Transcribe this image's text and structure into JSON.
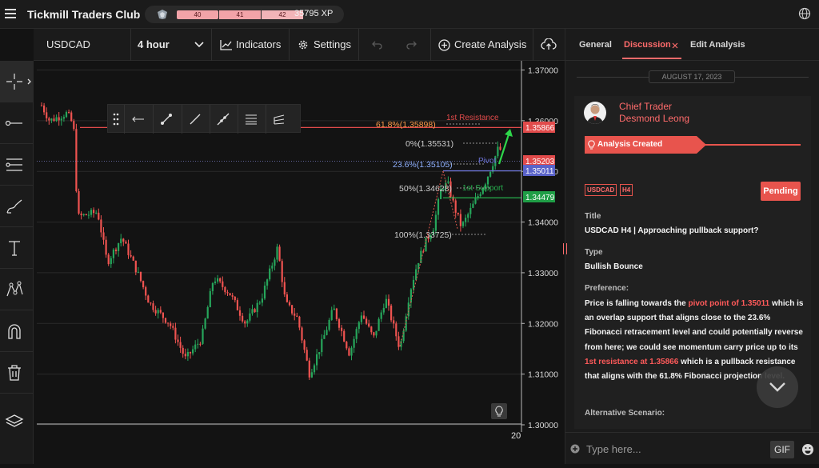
{
  "header": {
    "app_title": "Tickmill Traders Club",
    "progress": [
      "40",
      "41",
      "42"
    ],
    "xp": "35795 XP"
  },
  "toolbar": {
    "symbol": "USDCAD",
    "timeframe": "4 hour",
    "indicators": "Indicators",
    "settings": "Settings",
    "create_analysis": "Create Analysis"
  },
  "left_tools": [
    "crosshair-icon",
    "line-tool-icon",
    "fibonacci-icon",
    "brush-icon",
    "text-tool-icon",
    "pattern-icon",
    "magnet-icon",
    "trash-icon",
    "layers-icon"
  ],
  "chart_data": {
    "type": "candlestick",
    "symbol": "USDCAD",
    "interval": "4 hour",
    "y_ticks": [
      "1.37000",
      "1.36000",
      "1.35000",
      "1.34000",
      "1.33000",
      "1.32000",
      "1.31000",
      "1.30000"
    ],
    "ylim": [
      1.3,
      1.37
    ],
    "x_ticks": [
      "20"
    ],
    "price_badges": [
      {
        "value": "1.35866",
        "color": "#e14b4b"
      },
      {
        "value": "1.35203",
        "color": "#e14b4b"
      },
      {
        "value": "1.35011",
        "color": "#5a63c9"
      },
      {
        "value": "1.34479",
        "color": "#1f9e46"
      }
    ],
    "levels": [
      {
        "label": "1st Resistance",
        "price": 1.35866,
        "color": "#e14b4b"
      },
      {
        "label": "Pivot",
        "price": 1.35011,
        "color": "#6c73d8"
      },
      {
        "label": "1st Support",
        "price": 1.34479,
        "color": "#27b04e"
      }
    ],
    "fib_labels": [
      {
        "label": "61.8%(1.35898)",
        "price": 1.35898,
        "color": "#ff9a4a"
      },
      {
        "label": "0%(1.35531)",
        "price": 1.35531,
        "color": "#cfcfcf"
      },
      {
        "label": "23.6%(1.35105)",
        "price": 1.35105,
        "color": "#8fb0ff"
      },
      {
        "label": "50%(1.34628)",
        "price": 1.34628,
        "color": "#cfcfcf"
      },
      {
        "label": "100%(1.33725)",
        "price": 1.33725,
        "color": "#cfcfcf"
      }
    ]
  },
  "panel": {
    "tabs": [
      "General",
      "Discussion",
      "Edit Analysis"
    ],
    "date": "AUGUST 17, 2023",
    "author_role": "Chief Trader",
    "author_name": "Desmond Leong",
    "status_banner": "Analysis Created",
    "tags": [
      "USDCAD",
      "H4"
    ],
    "state": "Pending",
    "title_label": "Title",
    "title_value": "USDCAD H4 | Approaching pullback support?",
    "type_label": "Type",
    "type_value": "Bullish Bounce",
    "pref_label": "Preference:",
    "pref_a": "Price is falling towards the ",
    "pref_hl1": "pivot point of 1.35011",
    "pref_b": " which is an overlap support that aligns close to the 23.6% Fibonacci retracement level and could potentially reverse from here; we could see momentum carry price up to its ",
    "pref_hl2": "1st resistance at 1.35866",
    "pref_c": " which is a pullback resistance that aligns with the 61.8% Fibonacci projection level.",
    "alt_label": "Alternative Scenario:",
    "input_placeholder": "Type here...",
    "gif": "GIF"
  }
}
